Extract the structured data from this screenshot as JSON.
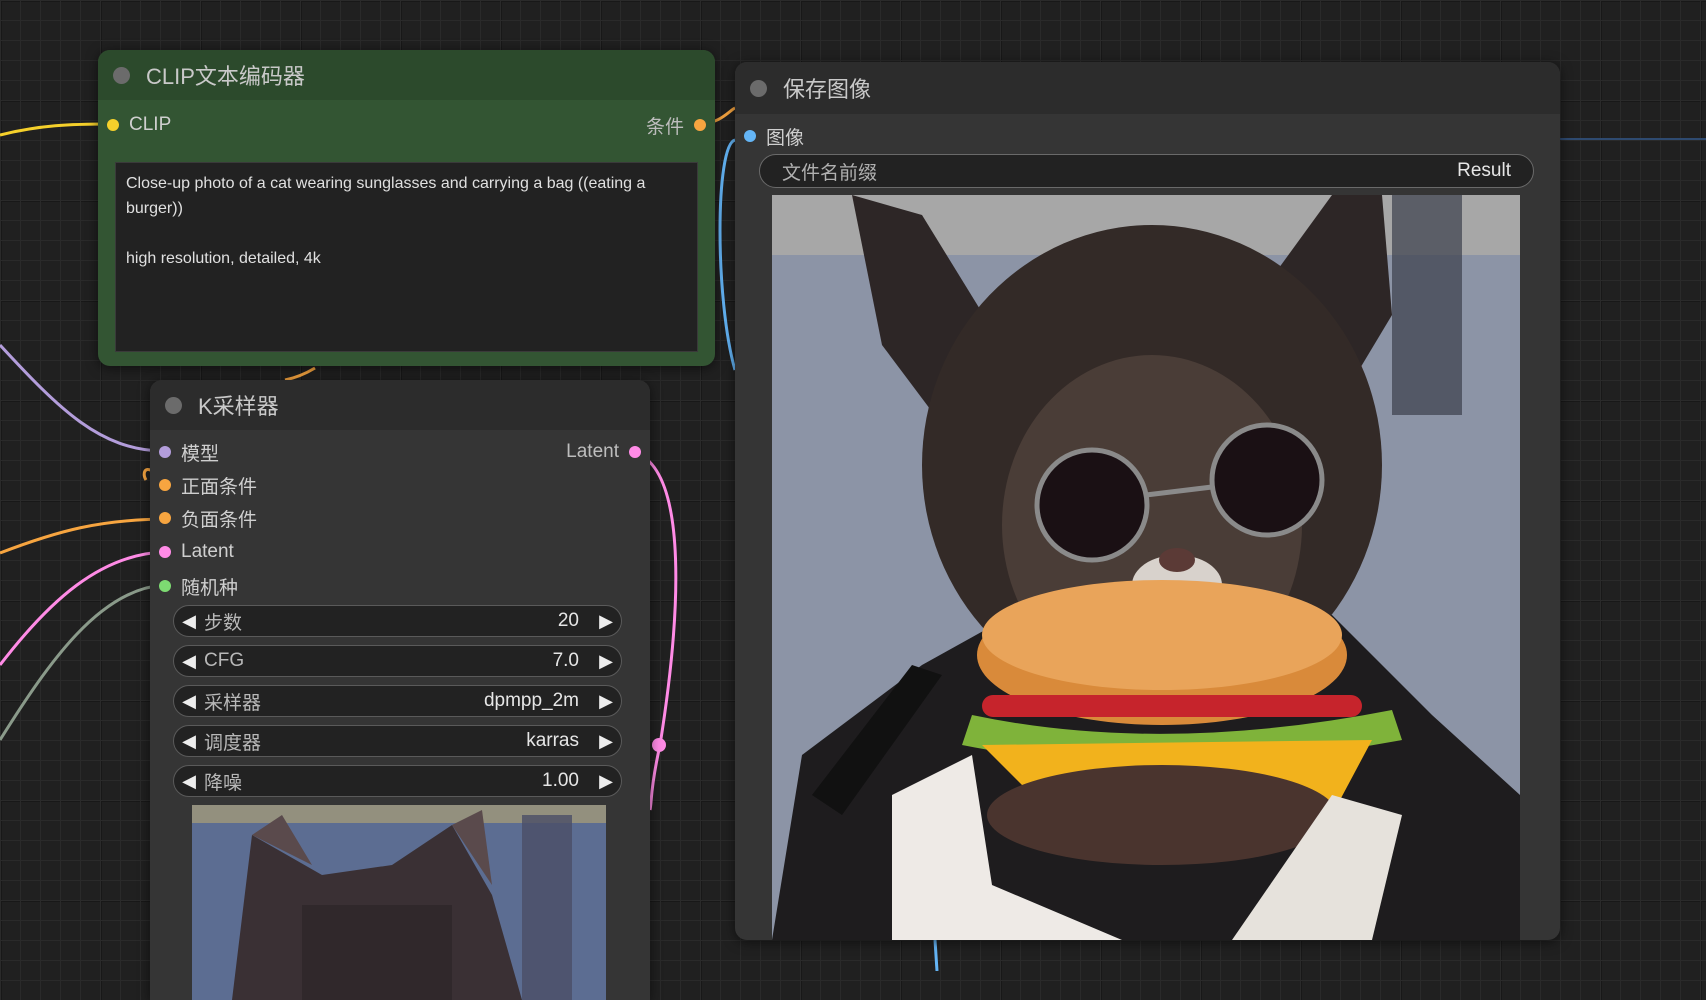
{
  "colors": {
    "clip": "#f5d02b",
    "conditioning": "#f7a540",
    "model": "#b39ddb",
    "latent": "#ff8be6",
    "seed": "#7ddb72",
    "image": "#64b5f6"
  },
  "clip_node": {
    "title": "CLIP文本编码器",
    "input_label": "CLIP",
    "output_label": "条件",
    "prompt": "Close-up photo of a cat wearing sunglasses and carrying a bag ((eating a burger))\n\nhigh resolution, detailed, 4k"
  },
  "ksampler_node": {
    "title": "K采样器",
    "inputs": [
      "模型",
      "正面条件",
      "负面条件",
      "Latent",
      "随机种"
    ],
    "output_label": "Latent",
    "widgets": [
      {
        "label": "步数",
        "value": "20"
      },
      {
        "label": "CFG",
        "value": "7.0"
      },
      {
        "label": "采样器",
        "value": "dpmpp_2m"
      },
      {
        "label": "调度器",
        "value": "karras"
      },
      {
        "label": "降噪",
        "value": "1.00"
      }
    ]
  },
  "save_node": {
    "title": "保存图像",
    "input_label": "图像",
    "prefix_label": "文件名前缀",
    "prefix_value": "Result"
  },
  "icons": {
    "arrow_left": "◀",
    "arrow_right": "▶",
    "node_status": "dot-icon",
    "preview_image": "cat-image",
    "result_image": "cat-burger-image"
  }
}
